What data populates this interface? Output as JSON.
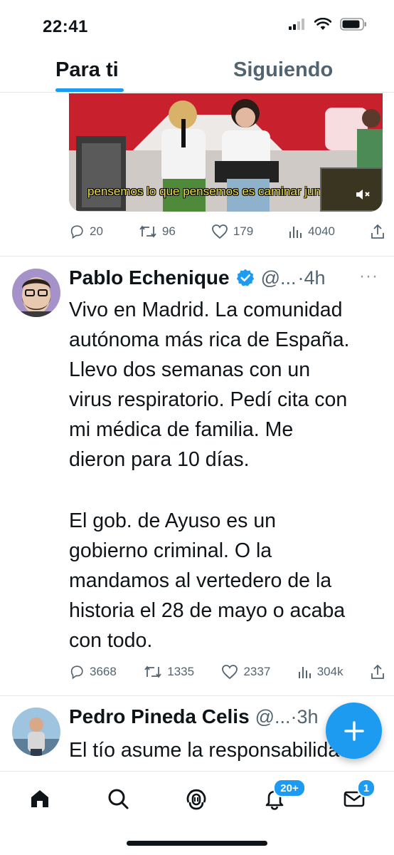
{
  "status_bar": {
    "time": "22:41"
  },
  "tabs": [
    {
      "label": "Para ti",
      "active": true
    },
    {
      "label": "Siguiendo",
      "active": false
    }
  ],
  "video_tweet": {
    "subtitle": "pensemos lo que pensemos es caminar juntas",
    "stats": {
      "replies": "20",
      "retweets": "96",
      "likes": "179",
      "views": "4040"
    }
  },
  "tweet": {
    "author": "Pablo Echenique",
    "handle": "@...",
    "time": "·4h",
    "paragraph1": "Vivo en Madrid. La comunidad\nautónoma más rica de España.\nLlevo dos semanas con un\nvirus respiratorio. Pedí cita con\nmi médica de familia. Me\ndieron para 10 días.",
    "paragraph2": "El gob. de Ayuso es un\ngobierno criminal. O la\nmandamos al vertedero de la\nhistoria el 28 de mayo o acaba\ncon todo.",
    "stats": {
      "replies": "3668",
      "retweets": "1335",
      "likes": "2337",
      "views": "304k"
    }
  },
  "next_tweet": {
    "author": "Pedro Pineda Celis",
    "handle": "@...·3h",
    "text": "El tío asume la responsabilidad"
  },
  "nav": {
    "notifications_badge": "20+",
    "messages_badge": "1"
  },
  "colors": {
    "accent": "#1d9bf0",
    "muted": "#536471"
  },
  "icons": [
    "home-icon",
    "search-icon",
    "spaces-icon",
    "notifications-icon",
    "messages-icon",
    "reply-icon",
    "retweet-icon",
    "like-icon",
    "views-icon",
    "share-icon",
    "verified-icon",
    "compose-icon"
  ]
}
